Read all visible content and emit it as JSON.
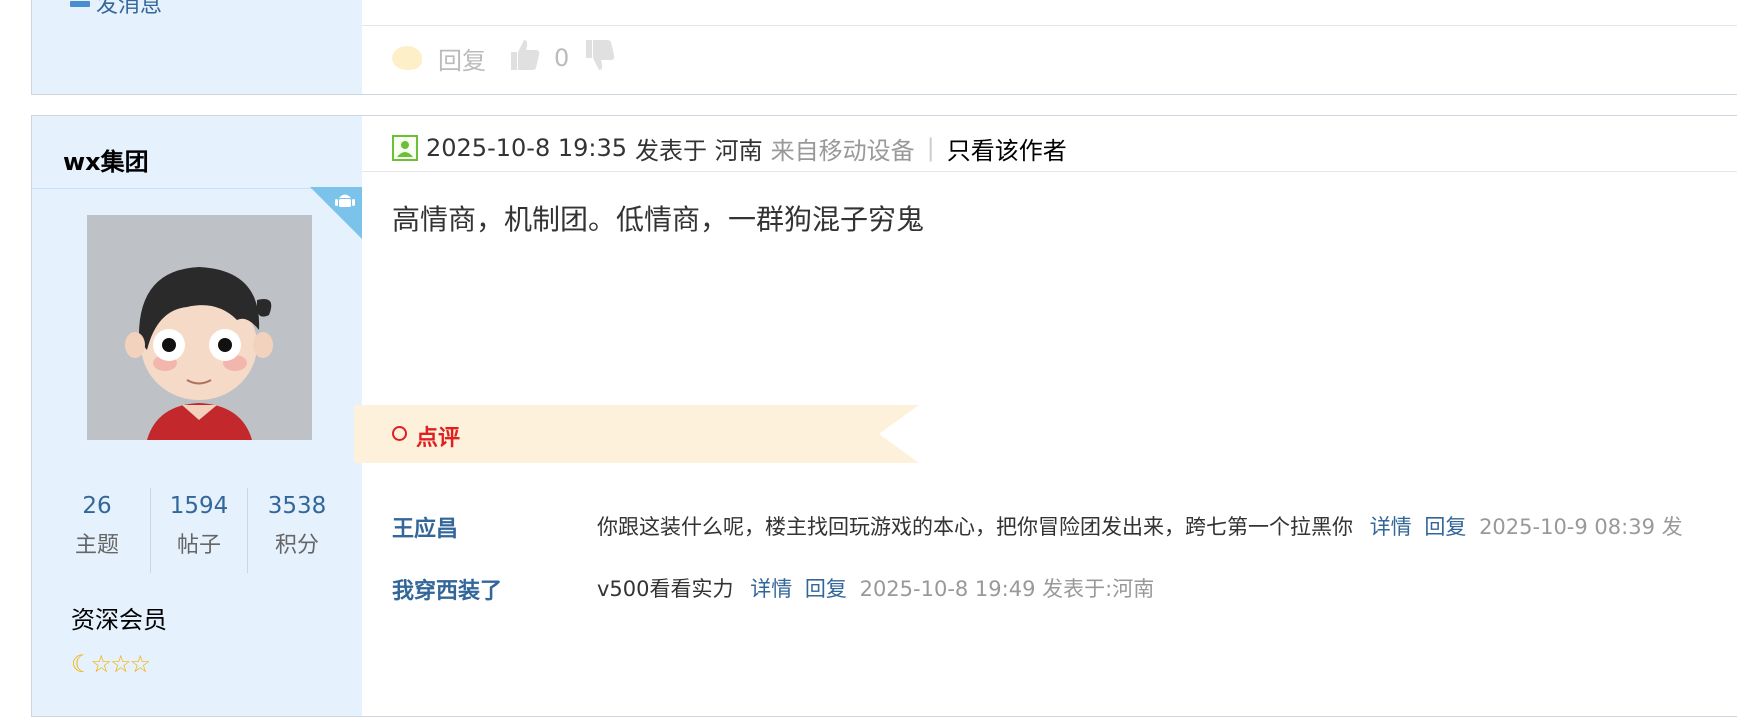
{
  "prev_post": {
    "sidebar_link": "发消息",
    "reply_label": "回复",
    "like_count": "0"
  },
  "post": {
    "username": "wx集团",
    "date_text": "2025-10-8 19:35",
    "posted_in": "发表于 河南",
    "device_text": "来自移动设备",
    "separator": "|",
    "only_author": "只看该作者",
    "content": "高情商，机制团。低情商，一群狗混子穷鬼",
    "stats": [
      {
        "value": "26",
        "label": "主题"
      },
      {
        "value": "1594",
        "label": "帖子"
      },
      {
        "value": "3538",
        "label": "积分"
      }
    ],
    "rank": "资深会员"
  },
  "comments_section": {
    "title": "点评",
    "comments": [
      {
        "author": "王应昌",
        "text": "你跟这装什么呢，楼主找回玩游戏的本心，把你冒险团发出来，跨七第一个拉黑你",
        "detail": "详情",
        "reply": "回复",
        "meta": "2025-10-9 08:39 发"
      },
      {
        "author": "我穿西装了",
        "text": "v500看看实力",
        "detail": "详情",
        "reply": "回复",
        "meta": "2025-10-8 19:49 发表于:河南"
      }
    ]
  },
  "colors": {
    "sidebar_bg": "#e5f1fd",
    "link_blue": "#336699",
    "comment_banner": "#fdf1dc",
    "comment_title_red": "#e02020"
  }
}
